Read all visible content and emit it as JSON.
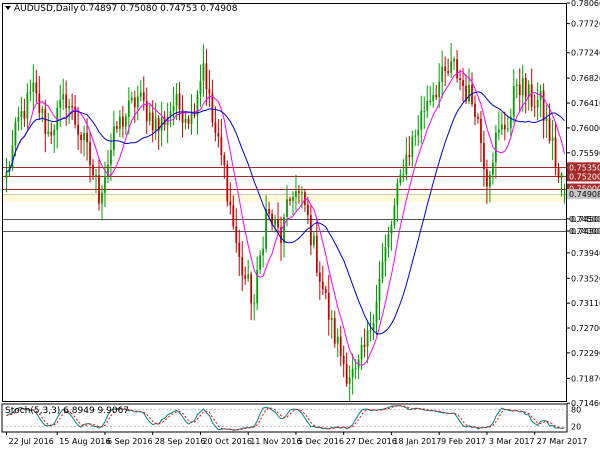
{
  "chart_data": {
    "type": "candlestick",
    "header": {
      "symbol": "AUDUSD,Daily",
      "ohlc": "0.74897 0.75080 0.74753 0.74908"
    },
    "price_axis": {
      "ylim": [
        0.7148,
        0.7806
      ],
      "ticks": [
        "0.78060",
        "0.77720",
        "0.77240",
        "0.76820",
        "0.76410",
        "0.76000",
        "0.75590",
        "0.74500",
        "0.74300",
        "0.73940",
        "0.73520",
        "0.73110",
        "0.72700",
        "0.72290",
        "0.71870",
        "0.71460"
      ]
    },
    "date_axis": {
      "ticks": [
        {
          "label": "22 Jul 2016",
          "index": 0
        },
        {
          "label": "15 Aug 2016",
          "index": 17
        },
        {
          "label": "6 Sep 2016",
          "index": 33
        },
        {
          "label": "28 Sep 2016",
          "index": 49
        },
        {
          "label": "20 Oct 2016",
          "index": 65
        },
        {
          "label": "11 Nov 2016",
          "index": 81
        },
        {
          "label": "5 Dec 2016",
          "index": 97
        },
        {
          "label": "27 Dec 2016",
          "index": 113
        },
        {
          "label": "18 Jan 2017",
          "index": 129
        },
        {
          "label": "9 Feb 2017",
          "index": 145
        },
        {
          "label": "3 Mar 2017",
          "index": 161
        },
        {
          "label": "27 Mar 2017",
          "index": 177
        }
      ]
    },
    "price_lines": [
      {
        "value": 0.7535,
        "label": "0.75350",
        "color": "#a52a2a",
        "filled": true
      },
      {
        "value": 0.752,
        "label": "0.75200",
        "color": "#a52a2a",
        "filled": true
      },
      {
        "value": 0.75,
        "label": "0.75000",
        "color": "#a52a2a",
        "filled": true
      },
      {
        "value": 0.74908,
        "label": "0.74908",
        "color": "#c8c8c8",
        "filled": true
      },
      {
        "value": 0.745,
        "label": "0.74500",
        "color": "#555555",
        "filled": false
      },
      {
        "value": 0.743,
        "label": "0.74300",
        "color": "#555555",
        "filled": false
      }
    ],
    "zone": {
      "from": 0.7492,
      "to": 0.7478,
      "color": "#fffbd9"
    },
    "anchors": [
      [
        0,
        0.752
      ],
      [
        4,
        0.761
      ],
      [
        9,
        0.766
      ],
      [
        14,
        0.759
      ],
      [
        20,
        0.765
      ],
      [
        27,
        0.756
      ],
      [
        31,
        0.749
      ],
      [
        37,
        0.76
      ],
      [
        44,
        0.765
      ],
      [
        51,
        0.76
      ],
      [
        56,
        0.764
      ],
      [
        62,
        0.762
      ],
      [
        66,
        0.771
      ],
      [
        69,
        0.761
      ],
      [
        73,
        0.753
      ],
      [
        78,
        0.738
      ],
      [
        83,
        0.731
      ],
      [
        87,
        0.746
      ],
      [
        92,
        0.742
      ],
      [
        96,
        0.75
      ],
      [
        100,
        0.747
      ],
      [
        104,
        0.738
      ],
      [
        109,
        0.727
      ],
      [
        114,
        0.72
      ],
      [
        117,
        0.719
      ],
      [
        121,
        0.725
      ],
      [
        125,
        0.735
      ],
      [
        129,
        0.744
      ],
      [
        133,
        0.754
      ],
      [
        137,
        0.759
      ],
      [
        141,
        0.765
      ],
      [
        146,
        0.768
      ],
      [
        150,
        0.77
      ],
      [
        154,
        0.766
      ],
      [
        157,
        0.764
      ],
      [
        161,
        0.752
      ],
      [
        164,
        0.758
      ],
      [
        169,
        0.762
      ],
      [
        171,
        0.768
      ],
      [
        175,
        0.765
      ],
      [
        179,
        0.764
      ],
      [
        183,
        0.757
      ],
      [
        186,
        0.749
      ]
    ],
    "ma_fast_period": 8,
    "ma_slow_period": 21,
    "ma_colors": {
      "fast": "#ff00ff",
      "slow": "#0000cd"
    },
    "candle_colors": {
      "up": "#00a000",
      "down": "#c80000"
    },
    "stochastic": {
      "label": "Stoch(5,3,3) 6.8949 9.9067",
      "ylim": [
        0,
        100
      ],
      "ticks": [
        "80",
        "20"
      ],
      "main_color": "#008080",
      "signal_color": "#ff0000"
    }
  }
}
